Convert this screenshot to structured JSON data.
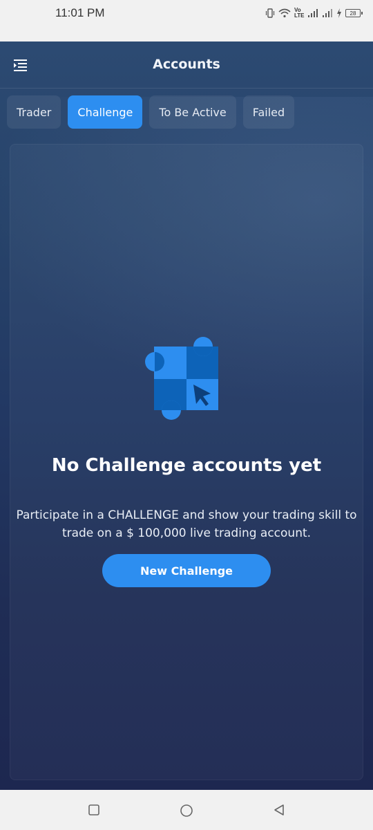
{
  "status_bar": {
    "time": "11:01 PM",
    "battery": "28",
    "network_label": "Vo LTE",
    "icons": [
      "vibrate-icon",
      "wifi-icon",
      "volte-icon",
      "signal-icon",
      "signal-icon",
      "charging-icon",
      "battery-icon"
    ]
  },
  "header": {
    "title": "Accounts",
    "menu_icon": "menu-icon"
  },
  "tabs": [
    {
      "label": "Trader",
      "active": false
    },
    {
      "label": "Challenge",
      "active": true
    },
    {
      "label": "To Be Active",
      "active": false
    },
    {
      "label": "Failed",
      "active": false
    }
  ],
  "empty_state": {
    "icon": "checkerboard-cursor-icon",
    "title": "No Challenge accounts yet",
    "text": "Participate in a CHALLENGE and show your trading skill to trade on a $ 100,000 live trading account.",
    "button_label": "New Challenge"
  },
  "nav_bar": {
    "icons": [
      "recent-apps-icon",
      "home-icon",
      "back-icon"
    ]
  },
  "colors": {
    "accent": "#2d8ef0",
    "background_top": "#2c4a72",
    "background_bottom": "#1d2750",
    "illustration_light": "#2d8ef0",
    "illustration_dark": "#0d63b8"
  }
}
